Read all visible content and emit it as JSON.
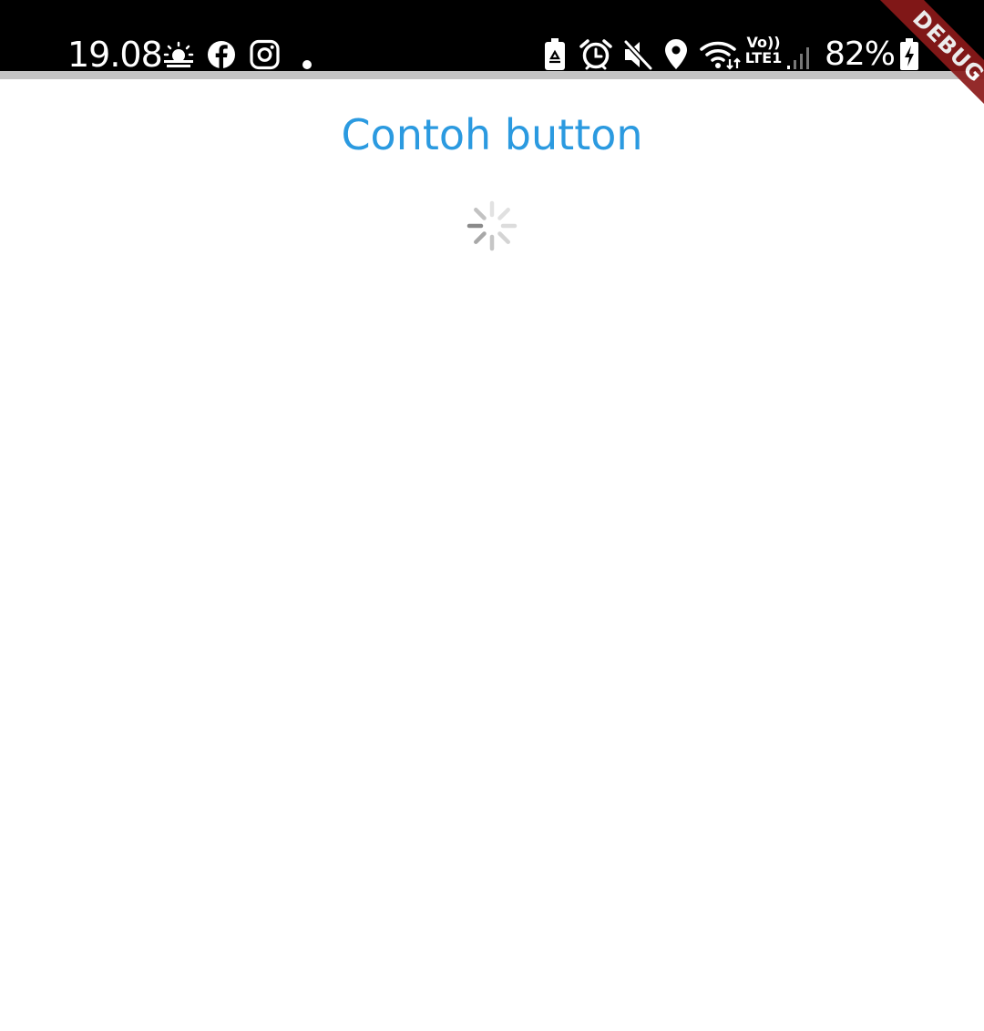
{
  "status_bar": {
    "time": "19.08",
    "icons": [
      "weather-sunrise-icon",
      "facebook-icon",
      "instagram-icon",
      "notification-dot-icon",
      "battery-saver-icon",
      "alarm-icon",
      "mute-icon",
      "location-icon",
      "wifi-icon",
      "signal-icon",
      "charging-icon"
    ],
    "network_vo": "Vo))",
    "network_lte": "LTE1",
    "battery_percent": "82%"
  },
  "debug_banner": "DEBUG",
  "main": {
    "title": "Contoh button",
    "loading": true
  },
  "colors": {
    "title": "#2b9ae0",
    "status_bar_bg": "#000000",
    "debug_ribbon": "#8b1a1a",
    "spinner": "#8a8a8a"
  }
}
